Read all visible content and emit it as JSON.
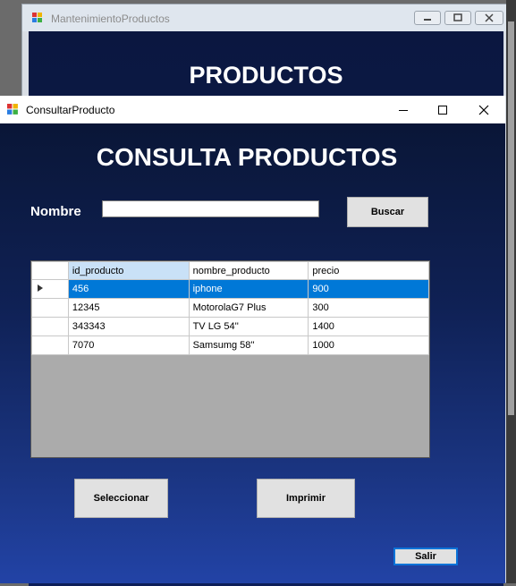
{
  "back_window": {
    "title": "MantenimientoProductos",
    "heading": "PRODUCTOS"
  },
  "window": {
    "title": "ConsultarProducto",
    "heading": "CONSULTA PRODUCTOS"
  },
  "search": {
    "label": "Nombre",
    "value": "",
    "button": "Buscar"
  },
  "grid": {
    "columns": [
      "id_producto",
      "nombre_producto",
      "precio"
    ],
    "rows": [
      [
        "456",
        "iphone",
        "900"
      ],
      [
        "12345",
        "MotorolaG7 Plus",
        "300"
      ],
      [
        "343343",
        "TV LG 54''",
        "1400"
      ],
      [
        "7070",
        "Samsumg 58''",
        "1000"
      ]
    ],
    "selected_row": 0
  },
  "buttons": {
    "seleccionar": "Seleccionar",
    "imprimir": "Imprimir",
    "salir": "Salir"
  },
  "colors": {
    "selection": "#0078d7",
    "background_top": "#0a1637",
    "background_bottom": "#2243a6"
  }
}
